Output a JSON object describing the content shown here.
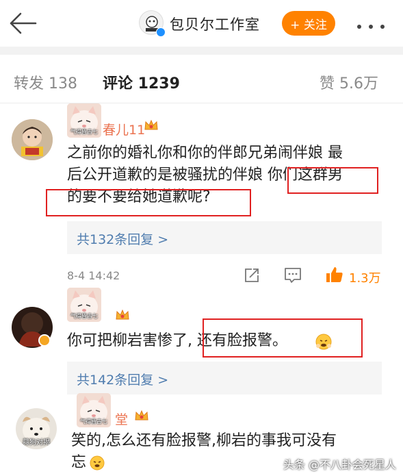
{
  "header": {
    "account_name": "包贝尔工作室",
    "follow_label": "+ 关注"
  },
  "tabs": {
    "repost": "转发 138",
    "comment": "评论 1239",
    "like": "赞 5.6万"
  },
  "comments": [
    {
      "username": "春儿11",
      "sticker_caption": "气得昏古七",
      "text_line1": "之前你的婚礼你和你的伴郎兄弟闹伴娘 最",
      "text_line2a": "后公开道歉的是被骚扰的伴娘 ",
      "text_line2b": "你们这群男",
      "text_line3": "的要不要给她道歉呢?",
      "replies": "共132条回复 >",
      "time": "8-4 14:42",
      "likes": "1.3万"
    },
    {
      "username": "",
      "sticker_caption": "气得昏古七",
      "text_a": "你可把柳岩害惨了,",
      "text_b": "还有脸报警。",
      "replies": "共142条回复 >"
    },
    {
      "username": "堂",
      "sticker_caption": "气得昏古七",
      "avatar_caption": "蒜狗对揭",
      "text_line1": "笑的,怎么还有脸报警,柳岩的事我可没有",
      "text_line2": "忘"
    }
  ],
  "watermark": "头条 @不八卦会死星人",
  "colors": {
    "accent": "#ff8200",
    "username": "#eb7350",
    "link": "#507daf",
    "highlight_box": "#e02020"
  }
}
